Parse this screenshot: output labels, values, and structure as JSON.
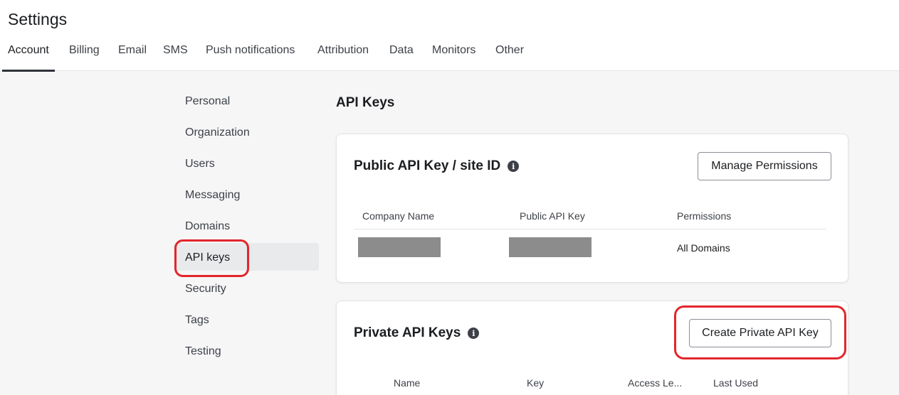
{
  "page": {
    "title": "Settings"
  },
  "tabs": [
    {
      "label": "Account",
      "active": true
    },
    {
      "label": "Billing"
    },
    {
      "label": "Email"
    },
    {
      "label": "SMS"
    },
    {
      "label": "Push notifications"
    },
    {
      "label": "Attribution"
    },
    {
      "label": "Data"
    },
    {
      "label": "Monitors"
    },
    {
      "label": "Other"
    }
  ],
  "sidebar": {
    "items": [
      {
        "label": "Personal"
      },
      {
        "label": "Organization"
      },
      {
        "label": "Users"
      },
      {
        "label": "Messaging"
      },
      {
        "label": "Domains"
      },
      {
        "label": "API keys",
        "selected": true
      },
      {
        "label": "Security"
      },
      {
        "label": "Tags"
      },
      {
        "label": "Testing"
      }
    ]
  },
  "main": {
    "section_title": "API Keys",
    "public_card": {
      "title": "Public API Key / site ID",
      "info_icon": "info-icon",
      "button_label": "Manage Permissions",
      "columns": [
        "Company Name",
        "Public API Key",
        "Permissions"
      ],
      "rows": [
        {
          "company_name": "[redacted]",
          "public_api_key": "[redacted]",
          "permissions": "All Domains"
        }
      ]
    },
    "private_card": {
      "title": "Private API Keys",
      "info_icon": "info-icon",
      "button_label": "Create Private API Key",
      "columns": [
        "Name",
        "Key",
        "Access Le...",
        "Last Used"
      ]
    }
  },
  "annotations": {
    "color": "#e3262b",
    "highlighted": [
      "API keys",
      "Create Private API Key"
    ]
  }
}
